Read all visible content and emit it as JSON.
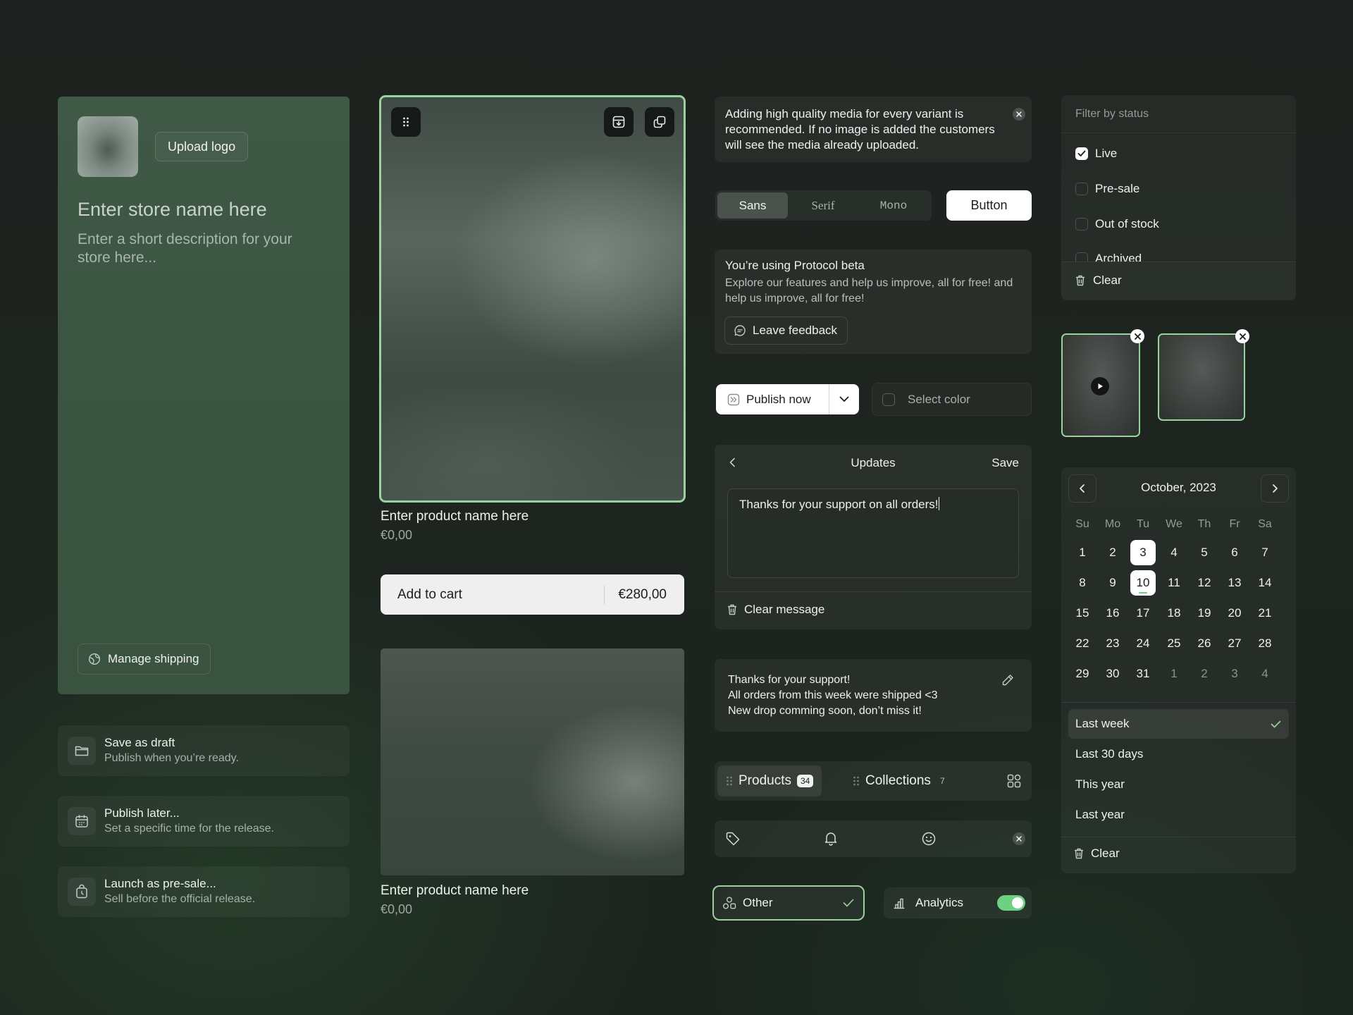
{
  "store": {
    "upload_logo": "Upload logo",
    "name_placeholder": "Enter store name here",
    "description_placeholder": "Enter a short description for your store here...",
    "manage_shipping": "Manage shipping"
  },
  "publish_options": [
    {
      "title": "Save as draft",
      "subtitle": "Publish when you’re ready.",
      "icon": "folder-icon"
    },
    {
      "title": "Publish later...",
      "subtitle": "Set a specific time for the release.",
      "icon": "calendar-icon"
    },
    {
      "title": "Launch as pre-sale...",
      "subtitle": "Sell before the official release.",
      "icon": "bag-clock-icon"
    }
  ],
  "product_card_1": {
    "name": "Enter product name here",
    "price": "€0,00"
  },
  "add_to_cart": {
    "label": "Add to cart",
    "price": "€280,00"
  },
  "product_card_2": {
    "name": "Enter product name here",
    "price": "€0,00"
  },
  "alert": {
    "text": "Adding high quality media for every variant is recommended. If no image is added the customers will see the media already uploaded."
  },
  "font_segment": {
    "options": [
      "Sans",
      "Serif",
      "Mono"
    ],
    "selected": "Sans"
  },
  "button_label": "Button",
  "beta": {
    "title": "You’re using Protocol beta",
    "body": "Explore our features and help us improve, all for free! and help us improve, all for free!",
    "feedback": "Leave feedback"
  },
  "publish": {
    "label": "Publish now"
  },
  "color_select": {
    "placeholder": "Select color"
  },
  "updates": {
    "title": "Updates",
    "save": "Save",
    "message": "Thanks for your support on all orders!",
    "clear": "Clear message"
  },
  "support_note": {
    "lines": [
      "Thanks for your support!",
      "All orders from this week were shipped <3",
      "New drop comming soon, don’t miss it!"
    ]
  },
  "tabs": [
    {
      "label": "Products",
      "count": "34",
      "active": true
    },
    {
      "label": "Collections",
      "count": "7",
      "active": false
    }
  ],
  "pills": {
    "other": "Other",
    "analytics": "Analytics",
    "analytics_on": true
  },
  "filter": {
    "heading": "Filter by status",
    "options": [
      {
        "label": "Live",
        "checked": true
      },
      {
        "label": "Pre-sale",
        "checked": false
      },
      {
        "label": "Out of stock",
        "checked": false
      },
      {
        "label": "Archived",
        "checked": false
      }
    ],
    "clear": "Clear"
  },
  "calendar": {
    "title": "October, 2023",
    "weekdays": [
      "Su",
      "Mo",
      "Tu",
      "We",
      "Th",
      "Fr",
      "Sa"
    ],
    "weeks": [
      [
        "1",
        "2",
        "3",
        "4",
        "5",
        "6",
        "7"
      ],
      [
        "8",
        "9",
        "10",
        "11",
        "12",
        "13",
        "14"
      ],
      [
        "15",
        "16",
        "17",
        "18",
        "19",
        "20",
        "21"
      ],
      [
        "22",
        "23",
        "24",
        "25",
        "26",
        "27",
        "28"
      ],
      [
        "29",
        "30",
        "31",
        "1",
        "2",
        "3",
        "4"
      ]
    ],
    "selected_days": [
      "3",
      "10"
    ],
    "today": "10",
    "ranges": [
      "Last week",
      "Last 30 days",
      "This year",
      "Last year"
    ],
    "active_range": "Last week",
    "clear": "Clear"
  },
  "colors": {
    "accent": "#9bd19d",
    "toggle_on": "#6fcf82"
  }
}
